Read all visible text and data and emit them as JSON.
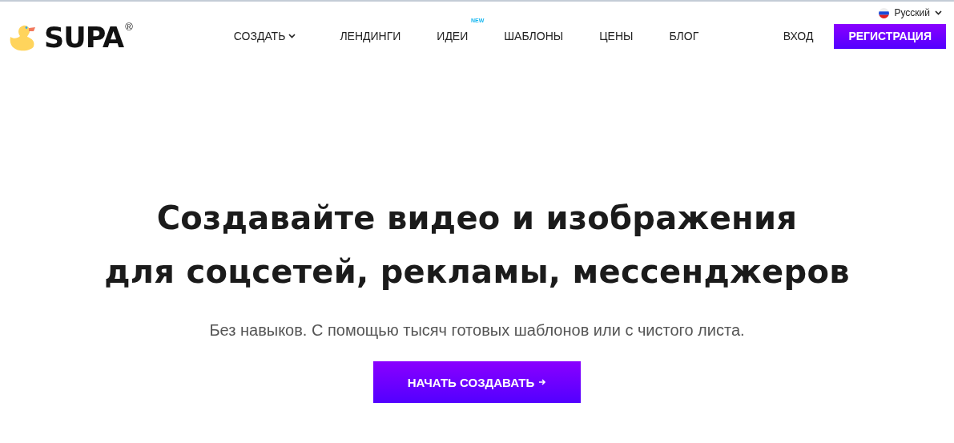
{
  "language": {
    "label": "Русский"
  },
  "logo": {
    "text": "SUPA",
    "mark": "®"
  },
  "nav": [
    {
      "label": "СОЗДАТЬ",
      "kind": "dropdown"
    },
    {
      "label": "ЛЕНДИНГИ",
      "kind": "link"
    },
    {
      "label": "ИДЕИ",
      "kind": "link",
      "badge": "NEW"
    },
    {
      "label": "ШАБЛОНЫ",
      "kind": "link"
    },
    {
      "label": "ЦЕНЫ",
      "kind": "link"
    },
    {
      "label": "БЛОГ",
      "kind": "link"
    }
  ],
  "login": "ВХОД",
  "register": "РЕГИСТРАЦИЯ",
  "hero": {
    "title_lines": [
      "Создавайте видео и изображения",
      "для соцсетей, рекламы, мессенджеров"
    ],
    "subtitle": "Без навыков. С помощью тысяч готовых шаблонов или с чистого листа.",
    "cta": "НАЧАТЬ СОЗДАВАТЬ"
  }
}
